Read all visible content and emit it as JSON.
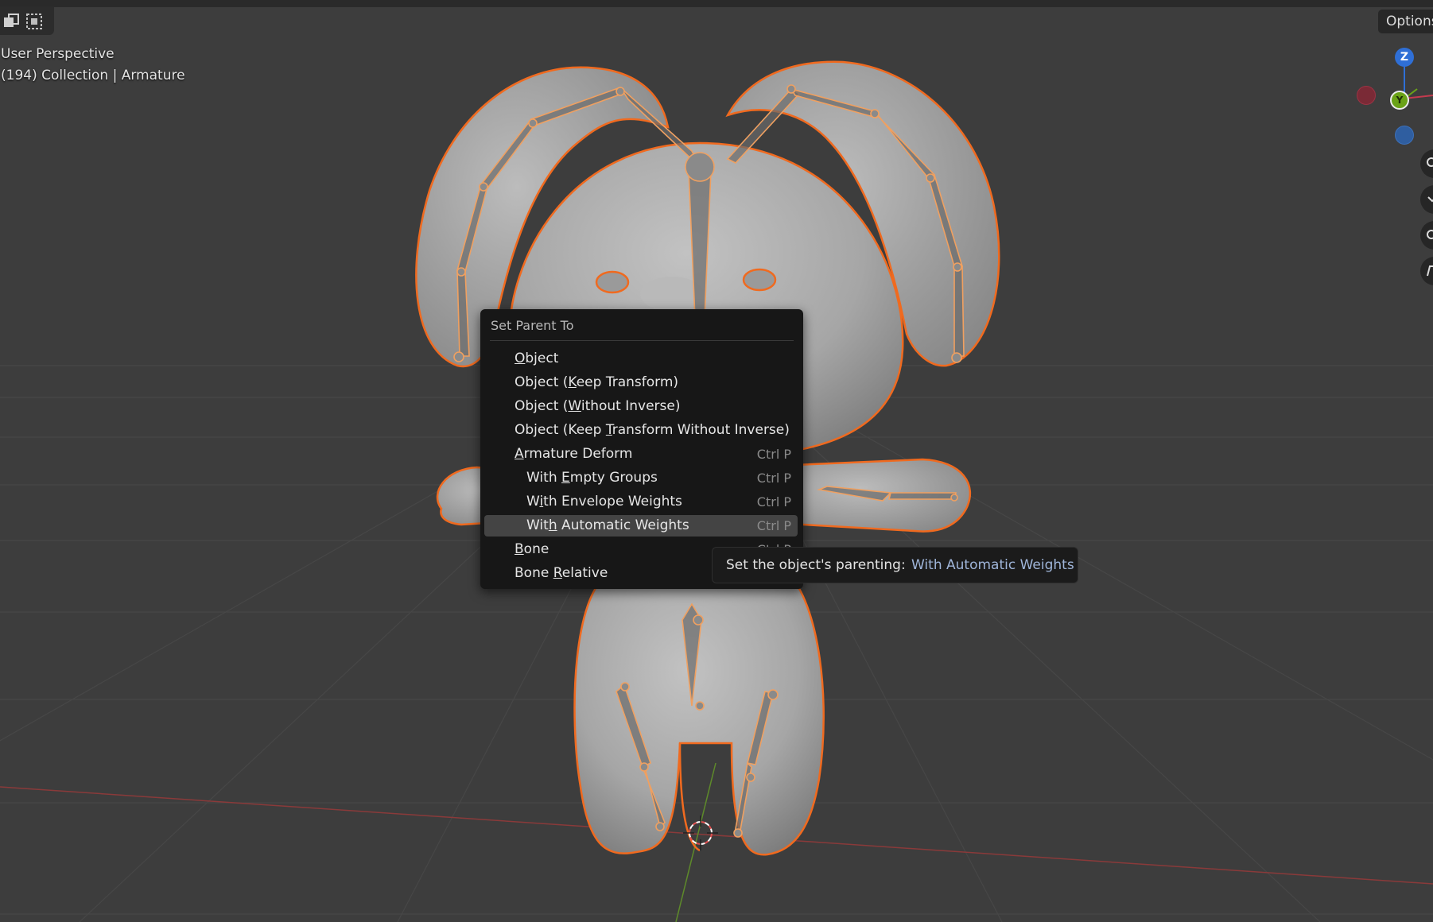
{
  "viewport": {
    "view_name": "User Perspective",
    "context_line": "(194) Collection | Armature",
    "options_label": "Options"
  },
  "gizmo": {
    "z_label": "Z",
    "y_label": "Y",
    "colors": {
      "z": "#2f6fd6",
      "y": "#6aa217",
      "x": "#c53a4e",
      "neg_z": "#2f5ea0"
    }
  },
  "toolbar": {
    "icons": [
      "select-box-icon",
      "select-dotted-icon"
    ]
  },
  "side_buttons": [
    "zoom-icon",
    "hand-pan-icon",
    "camera-icon",
    "grid-view-icon"
  ],
  "colors": {
    "selection_outline": "#f06a1f",
    "background": "#3d3d3d",
    "menu_bg": "#171717",
    "menu_highlight": "#444444"
  },
  "menu": {
    "title": "Set Parent To",
    "items": [
      {
        "pre": "",
        "key": "O",
        "post": "bject",
        "shortcut": "",
        "indent": false
      },
      {
        "pre": "Object (",
        "key": "K",
        "post": "eep Transform)",
        "shortcut": "",
        "indent": false
      },
      {
        "pre": "Object (",
        "key": "W",
        "post": "ithout Inverse)",
        "shortcut": "",
        "indent": false
      },
      {
        "pre": "Object (Keep ",
        "key": "T",
        "post": "ransform Without Inverse)",
        "shortcut": "",
        "indent": false
      },
      {
        "pre": "",
        "key": "A",
        "post": "rmature Deform",
        "shortcut": "Ctrl P",
        "indent": false
      },
      {
        "pre": "With ",
        "key": "E",
        "post": "mpty Groups",
        "shortcut": "Ctrl P",
        "indent": true
      },
      {
        "pre": "W",
        "key": "i",
        "post": "th Envelope Weights",
        "shortcut": "Ctrl P",
        "indent": true
      },
      {
        "pre": "Wit",
        "key": "h",
        "post": " Automatic Weights",
        "shortcut": "Ctrl P",
        "indent": true,
        "highlighted": true
      },
      {
        "pre": "",
        "key": "B",
        "post": "one",
        "shortcut": "Ctrl P",
        "indent": false
      },
      {
        "pre": "Bone ",
        "key": "R",
        "post": "elative",
        "shortcut": "",
        "indent": false
      }
    ]
  },
  "tooltip": {
    "description": "Set the object's parenting:",
    "value": "With Automatic Weights"
  }
}
